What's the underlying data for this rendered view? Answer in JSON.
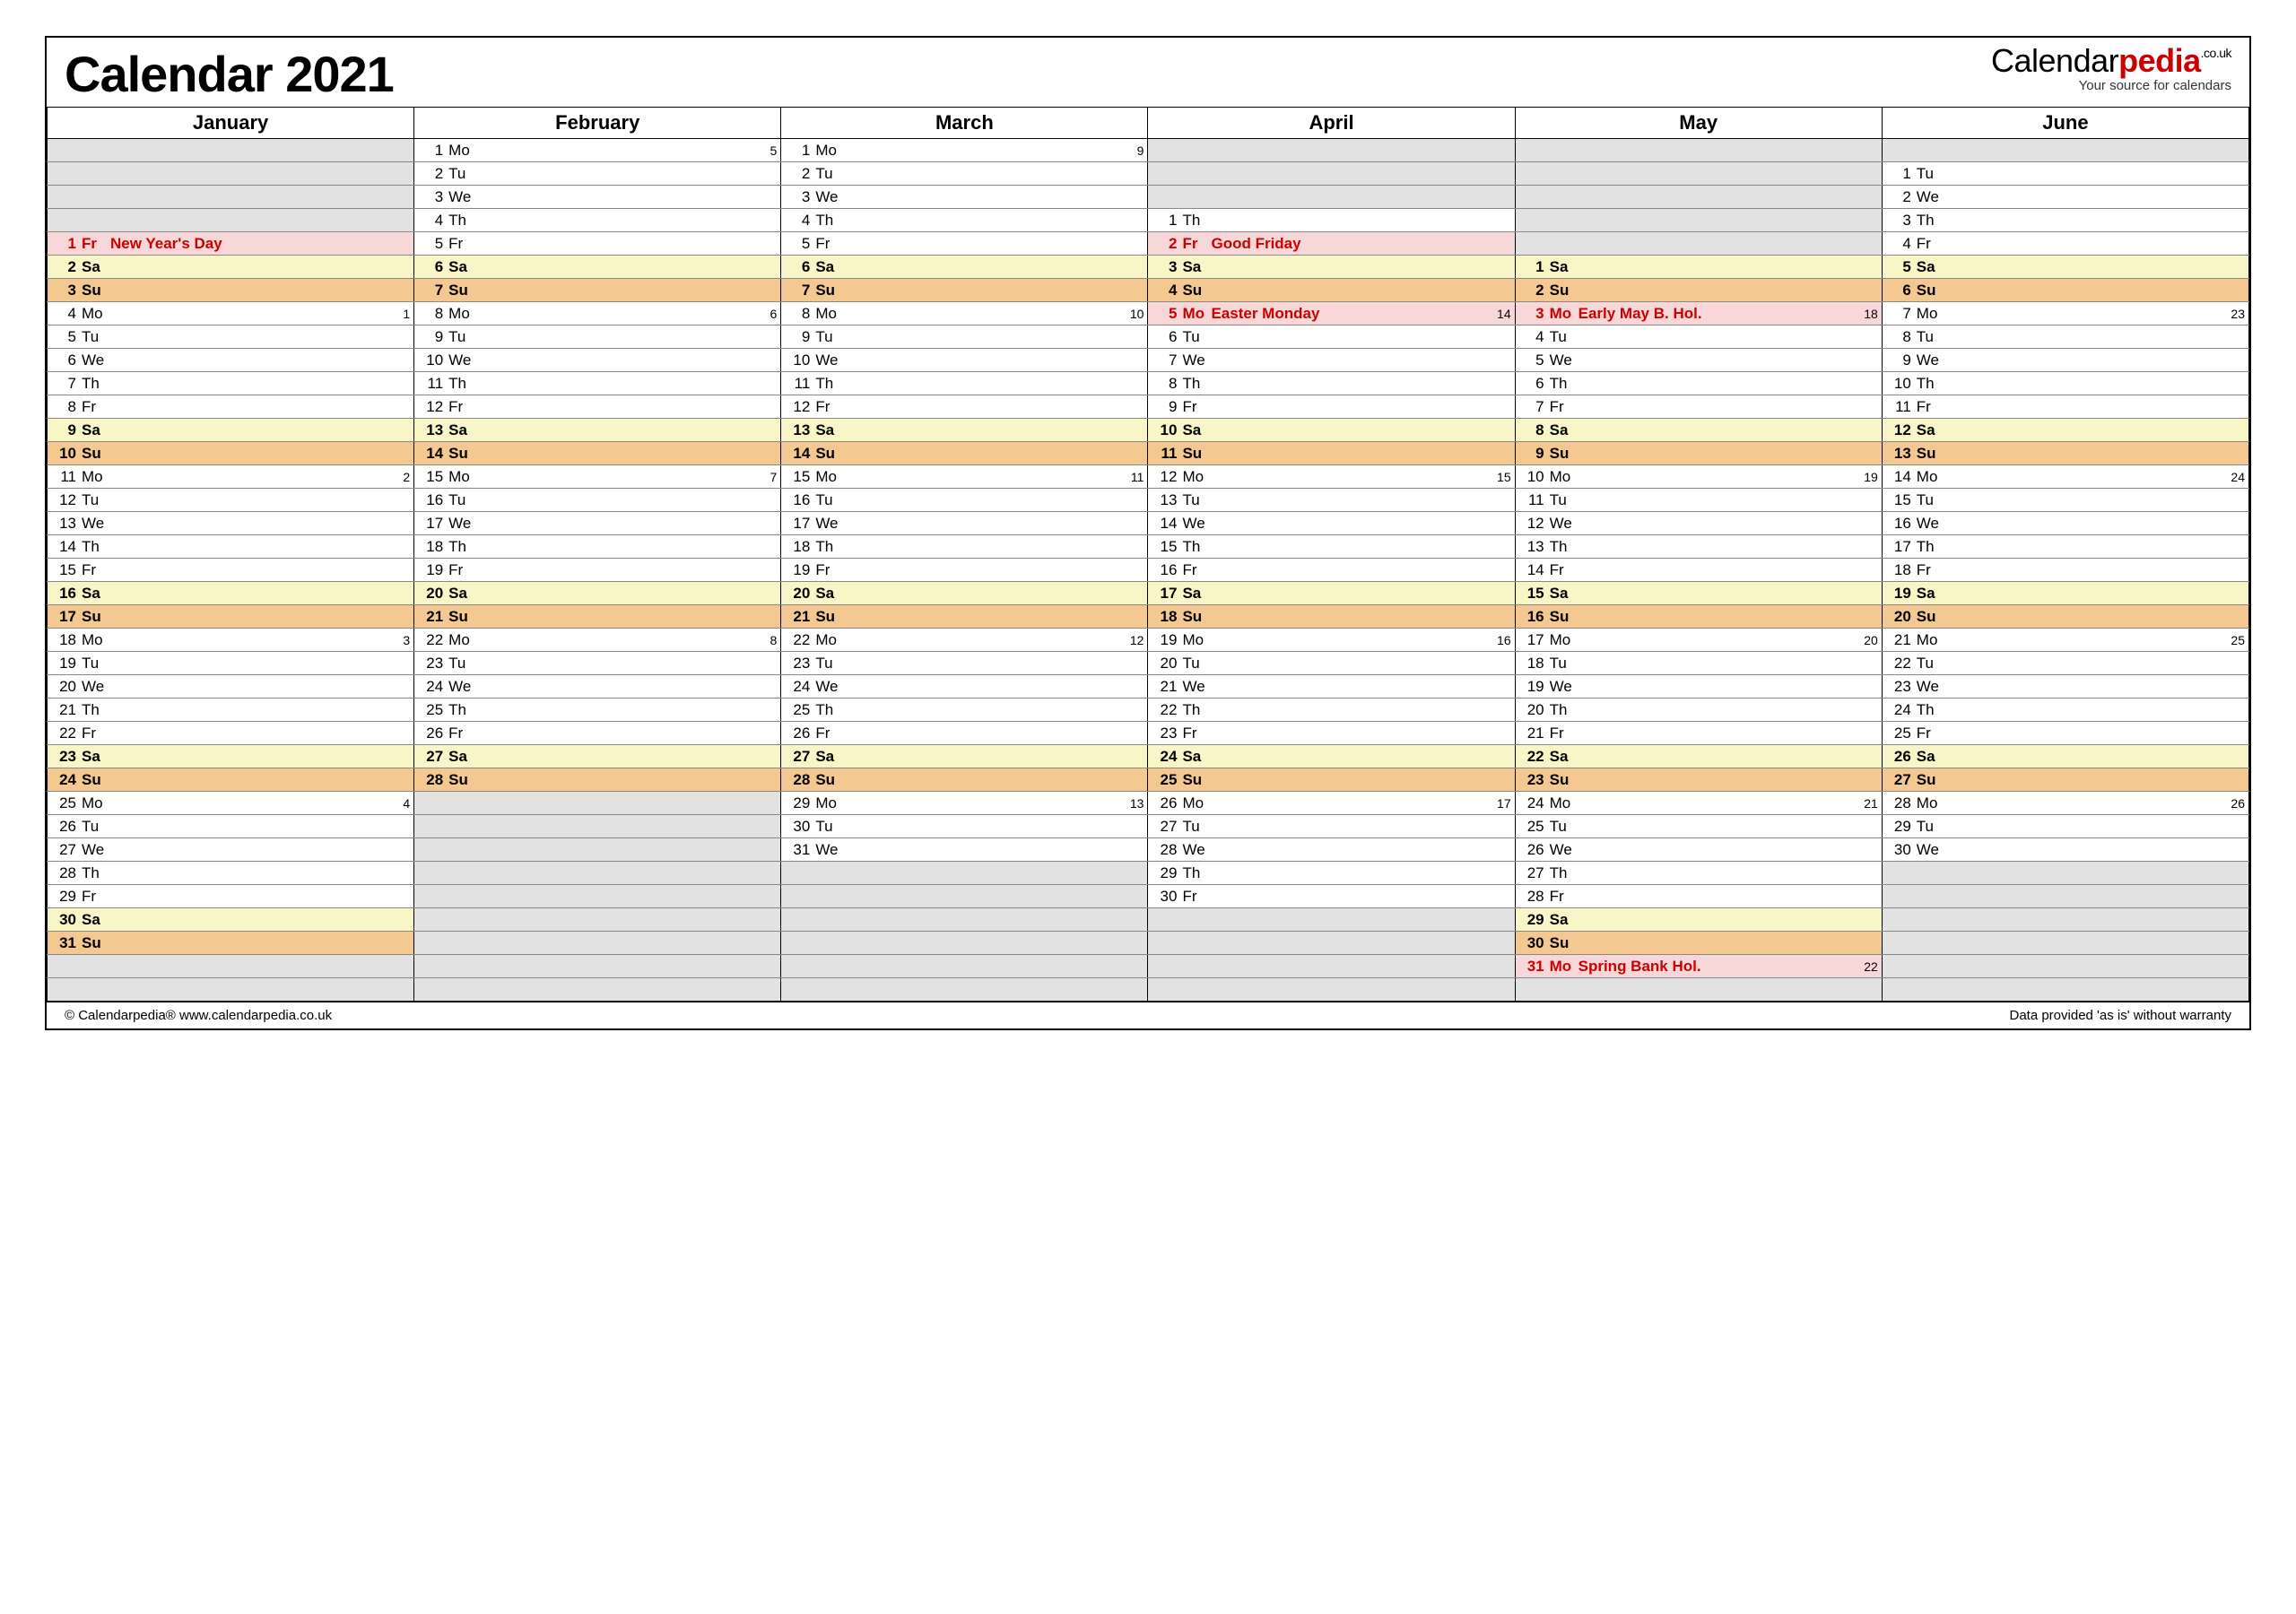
{
  "title": "Calendar 2021",
  "brand": {
    "name": "Calendarpedia",
    "tld": ".co.uk",
    "tagline": "Your source for calendars"
  },
  "footer": {
    "left": "© Calendarpedia®   www.calendarpedia.co.uk",
    "right": "Data provided 'as is' without warranty"
  },
  "colors": {
    "saturday": "#f8f6c7",
    "sunday": "#f4c891",
    "holiday_bg": "#f7d7d7",
    "holiday_text": "#c00",
    "empty": "#e2e2e2"
  },
  "dow_labels": [
    "Mo",
    "Tu",
    "We",
    "Th",
    "Fr",
    "Sa",
    "Su"
  ],
  "months": [
    {
      "name": "January",
      "lead_empty": 4,
      "days": [
        {
          "n": 1,
          "dow": "Fr",
          "note": "New Year's Day",
          "holiday": true
        },
        {
          "n": 2,
          "dow": "Sa"
        },
        {
          "n": 3,
          "dow": "Su"
        },
        {
          "n": 4,
          "dow": "Mo",
          "wk": 1
        },
        {
          "n": 5,
          "dow": "Tu"
        },
        {
          "n": 6,
          "dow": "We"
        },
        {
          "n": 7,
          "dow": "Th"
        },
        {
          "n": 8,
          "dow": "Fr"
        },
        {
          "n": 9,
          "dow": "Sa"
        },
        {
          "n": 10,
          "dow": "Su"
        },
        {
          "n": 11,
          "dow": "Mo",
          "wk": 2
        },
        {
          "n": 12,
          "dow": "Tu"
        },
        {
          "n": 13,
          "dow": "We"
        },
        {
          "n": 14,
          "dow": "Th"
        },
        {
          "n": 15,
          "dow": "Fr"
        },
        {
          "n": 16,
          "dow": "Sa"
        },
        {
          "n": 17,
          "dow": "Su"
        },
        {
          "n": 18,
          "dow": "Mo",
          "wk": 3
        },
        {
          "n": 19,
          "dow": "Tu"
        },
        {
          "n": 20,
          "dow": "We"
        },
        {
          "n": 21,
          "dow": "Th"
        },
        {
          "n": 22,
          "dow": "Fr"
        },
        {
          "n": 23,
          "dow": "Sa"
        },
        {
          "n": 24,
          "dow": "Su"
        },
        {
          "n": 25,
          "dow": "Mo",
          "wk": 4
        },
        {
          "n": 26,
          "dow": "Tu"
        },
        {
          "n": 27,
          "dow": "We"
        },
        {
          "n": 28,
          "dow": "Th"
        },
        {
          "n": 29,
          "dow": "Fr"
        },
        {
          "n": 30,
          "dow": "Sa"
        },
        {
          "n": 31,
          "dow": "Su"
        }
      ]
    },
    {
      "name": "February",
      "lead_empty": 0,
      "days": [
        {
          "n": 1,
          "dow": "Mo",
          "wk": 5
        },
        {
          "n": 2,
          "dow": "Tu"
        },
        {
          "n": 3,
          "dow": "We"
        },
        {
          "n": 4,
          "dow": "Th"
        },
        {
          "n": 5,
          "dow": "Fr"
        },
        {
          "n": 6,
          "dow": "Sa"
        },
        {
          "n": 7,
          "dow": "Su"
        },
        {
          "n": 8,
          "dow": "Mo",
          "wk": 6
        },
        {
          "n": 9,
          "dow": "Tu"
        },
        {
          "n": 10,
          "dow": "We"
        },
        {
          "n": 11,
          "dow": "Th"
        },
        {
          "n": 12,
          "dow": "Fr"
        },
        {
          "n": 13,
          "dow": "Sa"
        },
        {
          "n": 14,
          "dow": "Su"
        },
        {
          "n": 15,
          "dow": "Mo",
          "wk": 7
        },
        {
          "n": 16,
          "dow": "Tu"
        },
        {
          "n": 17,
          "dow": "We"
        },
        {
          "n": 18,
          "dow": "Th"
        },
        {
          "n": 19,
          "dow": "Fr"
        },
        {
          "n": 20,
          "dow": "Sa"
        },
        {
          "n": 21,
          "dow": "Su"
        },
        {
          "n": 22,
          "dow": "Mo",
          "wk": 8
        },
        {
          "n": 23,
          "dow": "Tu"
        },
        {
          "n": 24,
          "dow": "We"
        },
        {
          "n": 25,
          "dow": "Th"
        },
        {
          "n": 26,
          "dow": "Fr"
        },
        {
          "n": 27,
          "dow": "Sa"
        },
        {
          "n": 28,
          "dow": "Su"
        }
      ]
    },
    {
      "name": "March",
      "lead_empty": 0,
      "days": [
        {
          "n": 1,
          "dow": "Mo",
          "wk": 9
        },
        {
          "n": 2,
          "dow": "Tu"
        },
        {
          "n": 3,
          "dow": "We"
        },
        {
          "n": 4,
          "dow": "Th"
        },
        {
          "n": 5,
          "dow": "Fr"
        },
        {
          "n": 6,
          "dow": "Sa"
        },
        {
          "n": 7,
          "dow": "Su"
        },
        {
          "n": 8,
          "dow": "Mo",
          "wk": 10
        },
        {
          "n": 9,
          "dow": "Tu"
        },
        {
          "n": 10,
          "dow": "We"
        },
        {
          "n": 11,
          "dow": "Th"
        },
        {
          "n": 12,
          "dow": "Fr"
        },
        {
          "n": 13,
          "dow": "Sa"
        },
        {
          "n": 14,
          "dow": "Su"
        },
        {
          "n": 15,
          "dow": "Mo",
          "wk": 11
        },
        {
          "n": 16,
          "dow": "Tu"
        },
        {
          "n": 17,
          "dow": "We"
        },
        {
          "n": 18,
          "dow": "Th"
        },
        {
          "n": 19,
          "dow": "Fr"
        },
        {
          "n": 20,
          "dow": "Sa"
        },
        {
          "n": 21,
          "dow": "Su"
        },
        {
          "n": 22,
          "dow": "Mo",
          "wk": 12
        },
        {
          "n": 23,
          "dow": "Tu"
        },
        {
          "n": 24,
          "dow": "We"
        },
        {
          "n": 25,
          "dow": "Th"
        },
        {
          "n": 26,
          "dow": "Fr"
        },
        {
          "n": 27,
          "dow": "Sa"
        },
        {
          "n": 28,
          "dow": "Su"
        },
        {
          "n": 29,
          "dow": "Mo",
          "wk": 13
        },
        {
          "n": 30,
          "dow": "Tu"
        },
        {
          "n": 31,
          "dow": "We"
        }
      ]
    },
    {
      "name": "April",
      "lead_empty": 3,
      "days": [
        {
          "n": 1,
          "dow": "Th"
        },
        {
          "n": 2,
          "dow": "Fr",
          "note": "Good Friday",
          "holiday": true
        },
        {
          "n": 3,
          "dow": "Sa"
        },
        {
          "n": 4,
          "dow": "Su"
        },
        {
          "n": 5,
          "dow": "Mo",
          "wk": 14,
          "note": "Easter Monday",
          "holiday": true
        },
        {
          "n": 6,
          "dow": "Tu"
        },
        {
          "n": 7,
          "dow": "We"
        },
        {
          "n": 8,
          "dow": "Th"
        },
        {
          "n": 9,
          "dow": "Fr"
        },
        {
          "n": 10,
          "dow": "Sa"
        },
        {
          "n": 11,
          "dow": "Su"
        },
        {
          "n": 12,
          "dow": "Mo",
          "wk": 15
        },
        {
          "n": 13,
          "dow": "Tu"
        },
        {
          "n": 14,
          "dow": "We"
        },
        {
          "n": 15,
          "dow": "Th"
        },
        {
          "n": 16,
          "dow": "Fr"
        },
        {
          "n": 17,
          "dow": "Sa"
        },
        {
          "n": 18,
          "dow": "Su"
        },
        {
          "n": 19,
          "dow": "Mo",
          "wk": 16
        },
        {
          "n": 20,
          "dow": "Tu"
        },
        {
          "n": 21,
          "dow": "We"
        },
        {
          "n": 22,
          "dow": "Th"
        },
        {
          "n": 23,
          "dow": "Fr"
        },
        {
          "n": 24,
          "dow": "Sa"
        },
        {
          "n": 25,
          "dow": "Su"
        },
        {
          "n": 26,
          "dow": "Mo",
          "wk": 17
        },
        {
          "n": 27,
          "dow": "Tu"
        },
        {
          "n": 28,
          "dow": "We"
        },
        {
          "n": 29,
          "dow": "Th"
        },
        {
          "n": 30,
          "dow": "Fr"
        }
      ]
    },
    {
      "name": "May",
      "lead_empty": 5,
      "days": [
        {
          "n": 1,
          "dow": "Sa"
        },
        {
          "n": 2,
          "dow": "Su"
        },
        {
          "n": 3,
          "dow": "Mo",
          "wk": 18,
          "note": "Early May B. Hol.",
          "holiday": true
        },
        {
          "n": 4,
          "dow": "Tu"
        },
        {
          "n": 5,
          "dow": "We"
        },
        {
          "n": 6,
          "dow": "Th"
        },
        {
          "n": 7,
          "dow": "Fr"
        },
        {
          "n": 8,
          "dow": "Sa"
        },
        {
          "n": 9,
          "dow": "Su"
        },
        {
          "n": 10,
          "dow": "Mo",
          "wk": 19
        },
        {
          "n": 11,
          "dow": "Tu"
        },
        {
          "n": 12,
          "dow": "We"
        },
        {
          "n": 13,
          "dow": "Th"
        },
        {
          "n": 14,
          "dow": "Fr"
        },
        {
          "n": 15,
          "dow": "Sa"
        },
        {
          "n": 16,
          "dow": "Su"
        },
        {
          "n": 17,
          "dow": "Mo",
          "wk": 20
        },
        {
          "n": 18,
          "dow": "Tu"
        },
        {
          "n": 19,
          "dow": "We"
        },
        {
          "n": 20,
          "dow": "Th"
        },
        {
          "n": 21,
          "dow": "Fr"
        },
        {
          "n": 22,
          "dow": "Sa"
        },
        {
          "n": 23,
          "dow": "Su"
        },
        {
          "n": 24,
          "dow": "Mo",
          "wk": 21
        },
        {
          "n": 25,
          "dow": "Tu"
        },
        {
          "n": 26,
          "dow": "We"
        },
        {
          "n": 27,
          "dow": "Th"
        },
        {
          "n": 28,
          "dow": "Fr"
        },
        {
          "n": 29,
          "dow": "Sa"
        },
        {
          "n": 30,
          "dow": "Su"
        },
        {
          "n": 31,
          "dow": "Mo",
          "wk": 22,
          "note": "Spring Bank Hol.",
          "holiday": true
        }
      ]
    },
    {
      "name": "June",
      "lead_empty": 1,
      "days": [
        {
          "n": 1,
          "dow": "Tu"
        },
        {
          "n": 2,
          "dow": "We"
        },
        {
          "n": 3,
          "dow": "Th"
        },
        {
          "n": 4,
          "dow": "Fr"
        },
        {
          "n": 5,
          "dow": "Sa"
        },
        {
          "n": 6,
          "dow": "Su"
        },
        {
          "n": 7,
          "dow": "Mo",
          "wk": 23
        },
        {
          "n": 8,
          "dow": "Tu"
        },
        {
          "n": 9,
          "dow": "We"
        },
        {
          "n": 10,
          "dow": "Th"
        },
        {
          "n": 11,
          "dow": "Fr"
        },
        {
          "n": 12,
          "dow": "Sa"
        },
        {
          "n": 13,
          "dow": "Su"
        },
        {
          "n": 14,
          "dow": "Mo",
          "wk": 24
        },
        {
          "n": 15,
          "dow": "Tu"
        },
        {
          "n": 16,
          "dow": "We"
        },
        {
          "n": 17,
          "dow": "Th"
        },
        {
          "n": 18,
          "dow": "Fr"
        },
        {
          "n": 19,
          "dow": "Sa"
        },
        {
          "n": 20,
          "dow": "Su"
        },
        {
          "n": 21,
          "dow": "Mo",
          "wk": 25
        },
        {
          "n": 22,
          "dow": "Tu"
        },
        {
          "n": 23,
          "dow": "We"
        },
        {
          "n": 24,
          "dow": "Th"
        },
        {
          "n": 25,
          "dow": "Fr"
        },
        {
          "n": 26,
          "dow": "Sa"
        },
        {
          "n": 27,
          "dow": "Su"
        },
        {
          "n": 28,
          "dow": "Mo",
          "wk": 26
        },
        {
          "n": 29,
          "dow": "Tu"
        },
        {
          "n": 30,
          "dow": "We"
        }
      ]
    }
  ],
  "rows": 37
}
